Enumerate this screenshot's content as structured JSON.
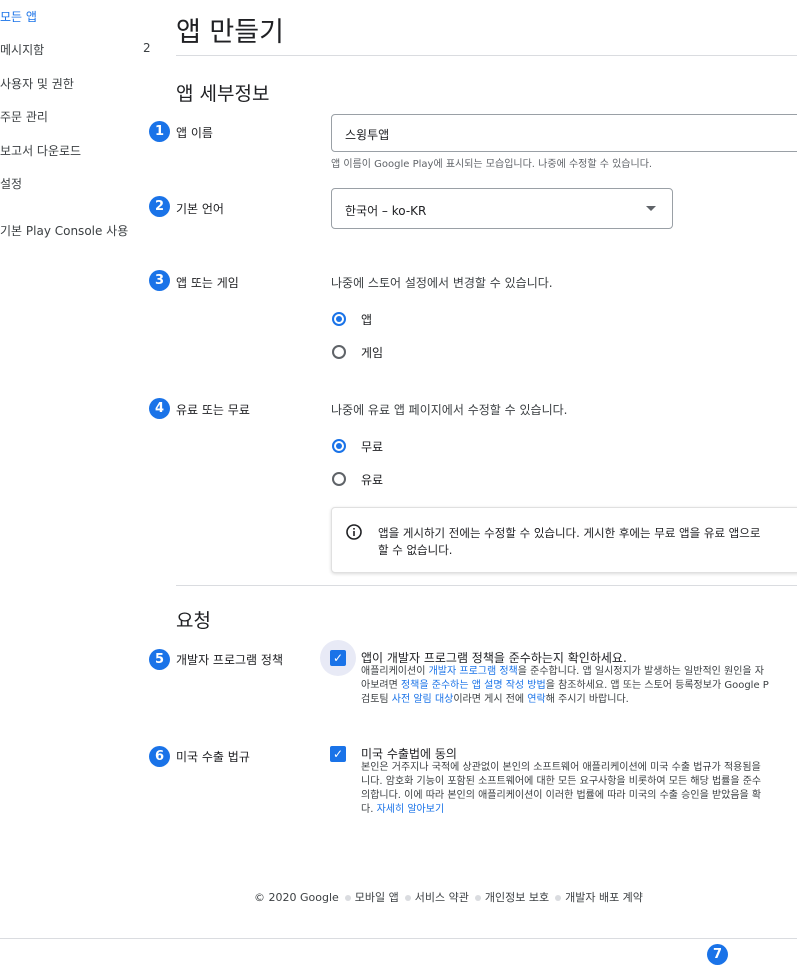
{
  "sidebar": {
    "items": [
      {
        "label": "모든 앱",
        "active": true
      },
      {
        "label": "메시지함",
        "count": "2"
      },
      {
        "label": "사용자 및 권한"
      },
      {
        "label": "주문 관리"
      },
      {
        "label": "보고서 다운로드"
      },
      {
        "label": "설정"
      },
      {
        "label": "기본 Play Console 사용"
      }
    ]
  },
  "page": {
    "title": "앱 만들기"
  },
  "details": {
    "heading": "앱 세부정보",
    "app_name": {
      "badge": "1",
      "label": "앱 이름",
      "value": "스윙투앱",
      "hint": "앱 이름이 Google Play에 표시되는 모습입니다. 나중에 수정할 수 있습니다."
    },
    "language": {
      "badge": "2",
      "label": "기본 언어",
      "value": "한국어 – ko-KR"
    },
    "app_or_game": {
      "badge": "3",
      "label": "앱 또는 게임",
      "desc": "나중에 스토어 설정에서 변경할 수 있습니다.",
      "options": [
        "앱",
        "게임"
      ],
      "selected": 0
    },
    "pricing": {
      "badge": "4",
      "label": "유료 또는 무료",
      "desc": "나중에 유료 앱 페이지에서 수정할 수 있습니다.",
      "options": [
        "무료",
        "유료"
      ],
      "selected": 0,
      "info_line1": "앱을 게시하기 전에는 수정할 수 있습니다. 게시한 후에는 무료 앱을 유료 앱으로",
      "info_line2": "할 수 없습니다."
    }
  },
  "requests": {
    "heading": "요청",
    "policy": {
      "badge": "5",
      "label": "개발자 프로그램 정책",
      "title": "앱이 개발자 프로그램 정책을 준수하는지 확인하세요.",
      "l1a": "애플리케이션이 ",
      "l1link": "개발자 프로그램 정책",
      "l1b": "을 준수합니다. 앱 일시정지가 발생하는 일반적인 원인을 자",
      "l2a": "아보려면 ",
      "l2link": "정책을 준수하는 앱 설명 작성 방법",
      "l2b": "을 참조하세요. 앱 또는 스토어 등록정보가 Google P",
      "l3a": "검토팀 ",
      "l3link": "사전 알림 대상",
      "l3b": "이라면 게시 전에 ",
      "l3link2": "연락",
      "l3c": "해 주시기 바랍니다."
    },
    "export": {
      "badge": "6",
      "label": "미국 수출 법규",
      "title": "미국 수출법에 동의",
      "l1": "본인은 거주지나 국적에 상관없이 본인의 소프트웨어 애플리케이션에 미국 수출 법규가 적용됨을",
      "l2": "니다. 암호화 기능이 포함된 소프트웨어에 대한 모든 요구사항을 비롯하여 모든 해당 법률을 준수",
      "l3": "의합니다. 이에 따라 본인의 애플리케이션이 이러한 법률에 따라 미국의 수출 승인을 받았음을 확",
      "l4a": "다. ",
      "l4link": "자세히 알아보기"
    }
  },
  "footer": {
    "copyright": "© 2020 Google",
    "links": [
      "모바일 앱",
      "서비스 약관",
      "개인정보 보호",
      "개발자 배포 계약"
    ]
  },
  "bottom_badge": "7",
  "colors": {
    "accent": "#1a73e8",
    "text": "#202124",
    "muted": "#5f6368"
  }
}
